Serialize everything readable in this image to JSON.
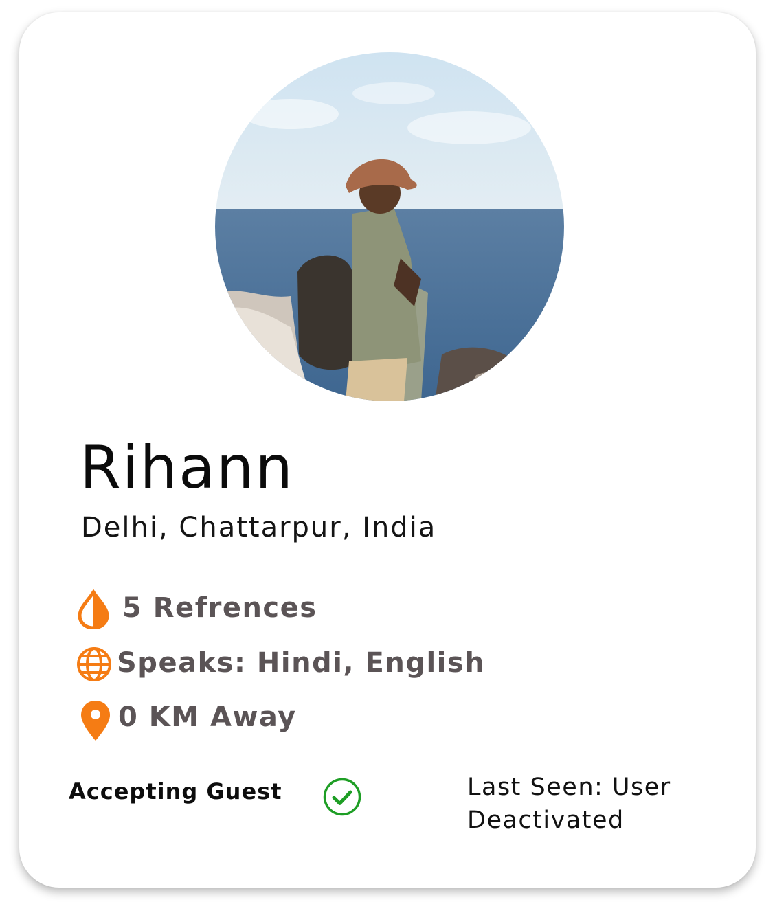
{
  "profile": {
    "name": "Rihann",
    "location": "Delhi, Chattarpur, India",
    "references": "5 Refrences",
    "speaks": "Speaks: Hindi, English",
    "distance": "0 KM Away",
    "accepting_label": "Accepting Guest",
    "accepting_status": true,
    "last_seen": "Last Seen: User Deactivated"
  },
  "icons": {
    "references": "water-drop-icon",
    "speaks": "globe-icon",
    "distance": "location-pin-icon",
    "accepting": "check-circle-icon"
  },
  "colors": {
    "accent": "#F57C14",
    "check": "#1E9E25",
    "info_text": "#5B5456"
  }
}
